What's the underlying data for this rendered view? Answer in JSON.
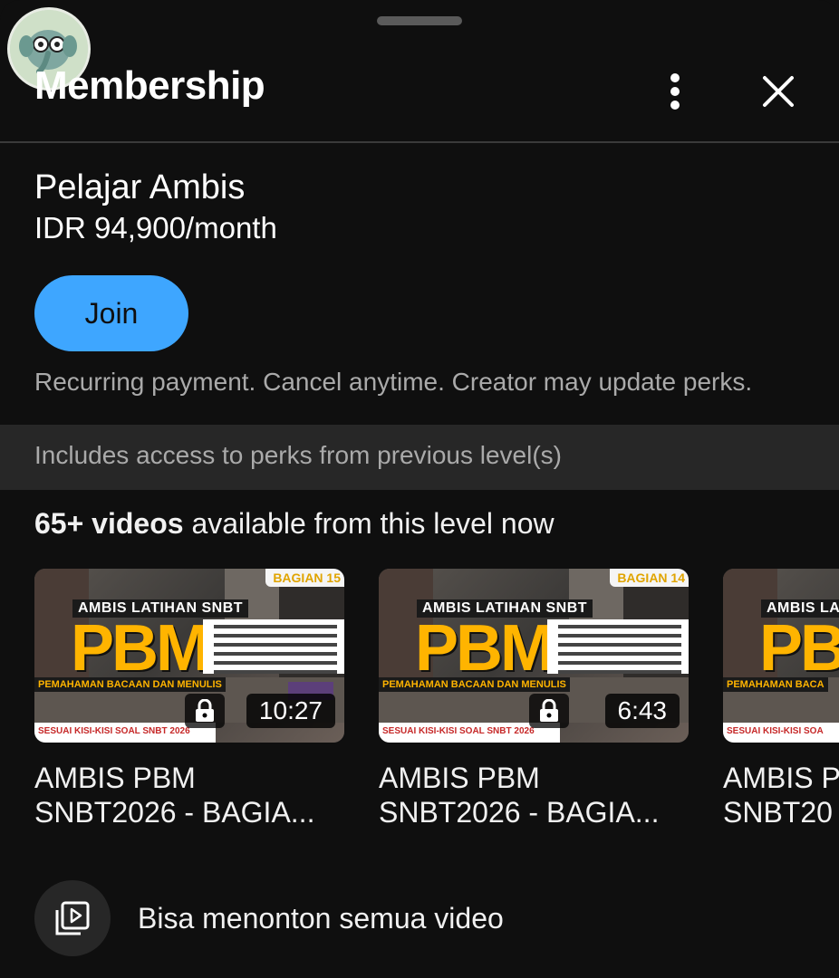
{
  "header": {
    "title": "Membership",
    "more_icon": "more-vert-icon",
    "close_icon": "close-icon"
  },
  "tier": {
    "name": "Pelajar Ambis",
    "price": "IDR 94,900/month",
    "join_label": "Join",
    "note": "Recurring payment. Cancel anytime. Creator may update perks."
  },
  "perks_banner": "Includes access to perks from previous level(s)",
  "videos": {
    "count": "65+ videos",
    "rest": " available from this level now",
    "items": [
      {
        "thumb_part": "BAGIAN 15",
        "thumb_ambis": "AMBIS LATIHAN SNBT",
        "thumb_pbm": "PBM",
        "thumb_subtitle": "PEMAHAMAN BACAAN DAN MENULIS",
        "thumb_strip": "SESUAI KISI-KISI SOAL SNBT 2026",
        "duration": "10:27",
        "title_line1": "AMBIS PBM",
        "title_line2": "SNBT2026 - BAGIA..."
      },
      {
        "thumb_part": "BAGIAN 14",
        "thumb_ambis": "AMBIS LATIHAN SNBT",
        "thumb_pbm": "PBM",
        "thumb_subtitle": "PEMAHAMAN BACAAN DAN MENULIS",
        "thumb_strip": "SESUAI KISI-KISI SOAL SNBT 2026",
        "duration": "6:43",
        "title_line1": "AMBIS PBM",
        "title_line2": "SNBT2026 - BAGIA..."
      },
      {
        "thumb_part": "",
        "thumb_ambis": "AMBIS LA",
        "thumb_pbm": "PBI",
        "thumb_subtitle": "PEMAHAMAN BACA",
        "thumb_strip": "SESUAI KISI-KISI SOA",
        "duration": "",
        "title_line1": "AMBIS P",
        "title_line2": "SNBT20"
      }
    ]
  },
  "perk_item": {
    "icon": "video-library-icon",
    "label": "Bisa menonton semua video"
  },
  "colors": {
    "background": "#0f0f0f",
    "accent": "#3ea6ff",
    "banner": "#272727",
    "muted_text": "#aaaaaa"
  }
}
